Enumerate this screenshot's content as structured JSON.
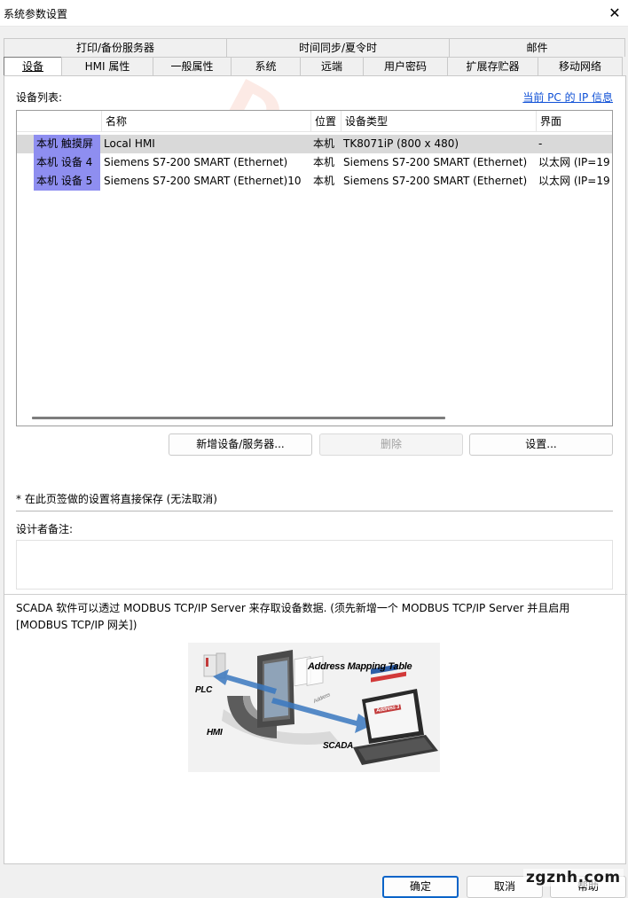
{
  "window": {
    "title": "系统参数设置",
    "close_glyph": "✕"
  },
  "tabs": {
    "row1": [
      "打印/备份服务器",
      "时间同步/夏令时",
      "邮件"
    ],
    "row2": [
      "设备",
      "HMI 属性",
      "一般属性",
      "系统",
      "远端",
      "用户密码",
      "扩展存贮器",
      "移动网络"
    ],
    "active": "设备"
  },
  "device_panel": {
    "list_label": "设备列表:",
    "ip_link": "当前 PC 的 IP 信息",
    "columns": [
      "名称",
      "位置",
      "设备类型",
      "界面"
    ],
    "rows": [
      {
        "head": "本机 触摸屏",
        "name": "Local HMI",
        "location": "本机",
        "type": "TK8071iP (800 x 480)",
        "interface": "-"
      },
      {
        "head": "本机 设备 4",
        "name": "Siemens S7-200 SMART (Ethernet)",
        "location": "本机",
        "type": "Siemens S7-200 SMART (Ethernet)",
        "interface": "以太网 (IP=19"
      },
      {
        "head": "本机 设备 5",
        "name": "Siemens S7-200 SMART (Ethernet)10",
        "location": "本机",
        "type": "Siemens S7-200 SMART (Ethernet)",
        "interface": "以太网 (IP=19"
      }
    ],
    "selected_row": 0
  },
  "watermark": "DATAIE",
  "buttons": {
    "add": "新增设备/服务器...",
    "delete": "删除",
    "settings": "设置..."
  },
  "note": "* 在此页签做的设置将直接保存 (无法取消)",
  "designer": {
    "label": "设计者备注:",
    "value": ""
  },
  "scada_text": "SCADA 软件可以透过 MODBUS TCP/IP Server 来存取设备数据. (须先新增一个 MODBUS TCP/IP Server 并且启用 [MODBUS TCP/IP 网关])",
  "diagram": {
    "labels": {
      "address_mapping": "Address Mapping Table",
      "plc": "PLC",
      "hmi": "HMI",
      "scada": "SCADA",
      "address": "Address",
      "screen_banner": "Address 3"
    }
  },
  "footer": {
    "ok": "确定",
    "cancel": "取消",
    "help": "帮助",
    "site_watermark": "zgznh.com"
  },
  "colors": {
    "row_head": "#8e8ef0",
    "selected_row": "#d9d9d9",
    "link": "#0f50d6",
    "primary_border": "#0a64c8"
  }
}
